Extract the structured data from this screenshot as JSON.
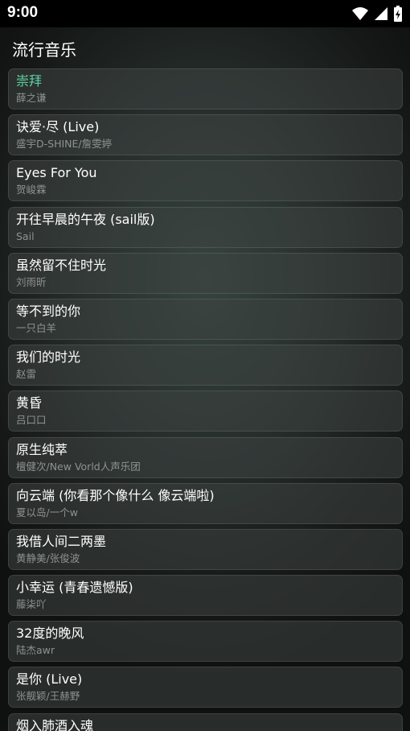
{
  "status_bar": {
    "time": "9:00",
    "icons": [
      "wifi-icon",
      "cellular-signal-icon",
      "battery-charging-icon"
    ]
  },
  "app": {
    "title": "流行音乐"
  },
  "colors": {
    "active_title": "#5fd0a3",
    "artist_text": "#8d9391"
  },
  "songs": [
    {
      "title": "崇拜",
      "artist": "薛之谦",
      "active": true
    },
    {
      "title": "诀爱·尽 (Live)",
      "artist": "盛宇D-SHINE/詹雯婷",
      "active": false
    },
    {
      "title": "Eyes For You",
      "artist": "贺峻霖",
      "active": false
    },
    {
      "title": "开往早晨的午夜 (sail版)",
      "artist": "Sail",
      "active": false
    },
    {
      "title": "虽然留不住时光",
      "artist": "刘雨昕",
      "active": false
    },
    {
      "title": "等不到的你",
      "artist": "一只白羊",
      "active": false
    },
    {
      "title": "我们的时光",
      "artist": "赵雷",
      "active": false
    },
    {
      "title": "黄昏",
      "artist": "吕口口",
      "active": false
    },
    {
      "title": "原生纯萃",
      "artist": "檀健次/New Vorld人声乐团",
      "active": false
    },
    {
      "title": "向云端 (你看那个像什么 像云端啦)",
      "artist": "夏以岛/一个w",
      "active": false
    },
    {
      "title": "我借人间二两墨",
      "artist": "黄静美/张俊波",
      "active": false
    },
    {
      "title": "小幸运 (青春遗憾版)",
      "artist": "藤柒吖",
      "active": false
    },
    {
      "title": "32度的晚风",
      "artist": "陆杰awr",
      "active": false
    },
    {
      "title": "是你 (Live)",
      "artist": "张靓颖/王赫野",
      "active": false
    },
    {
      "title": "烟入肺酒入魂",
      "artist": "",
      "active": false
    }
  ]
}
